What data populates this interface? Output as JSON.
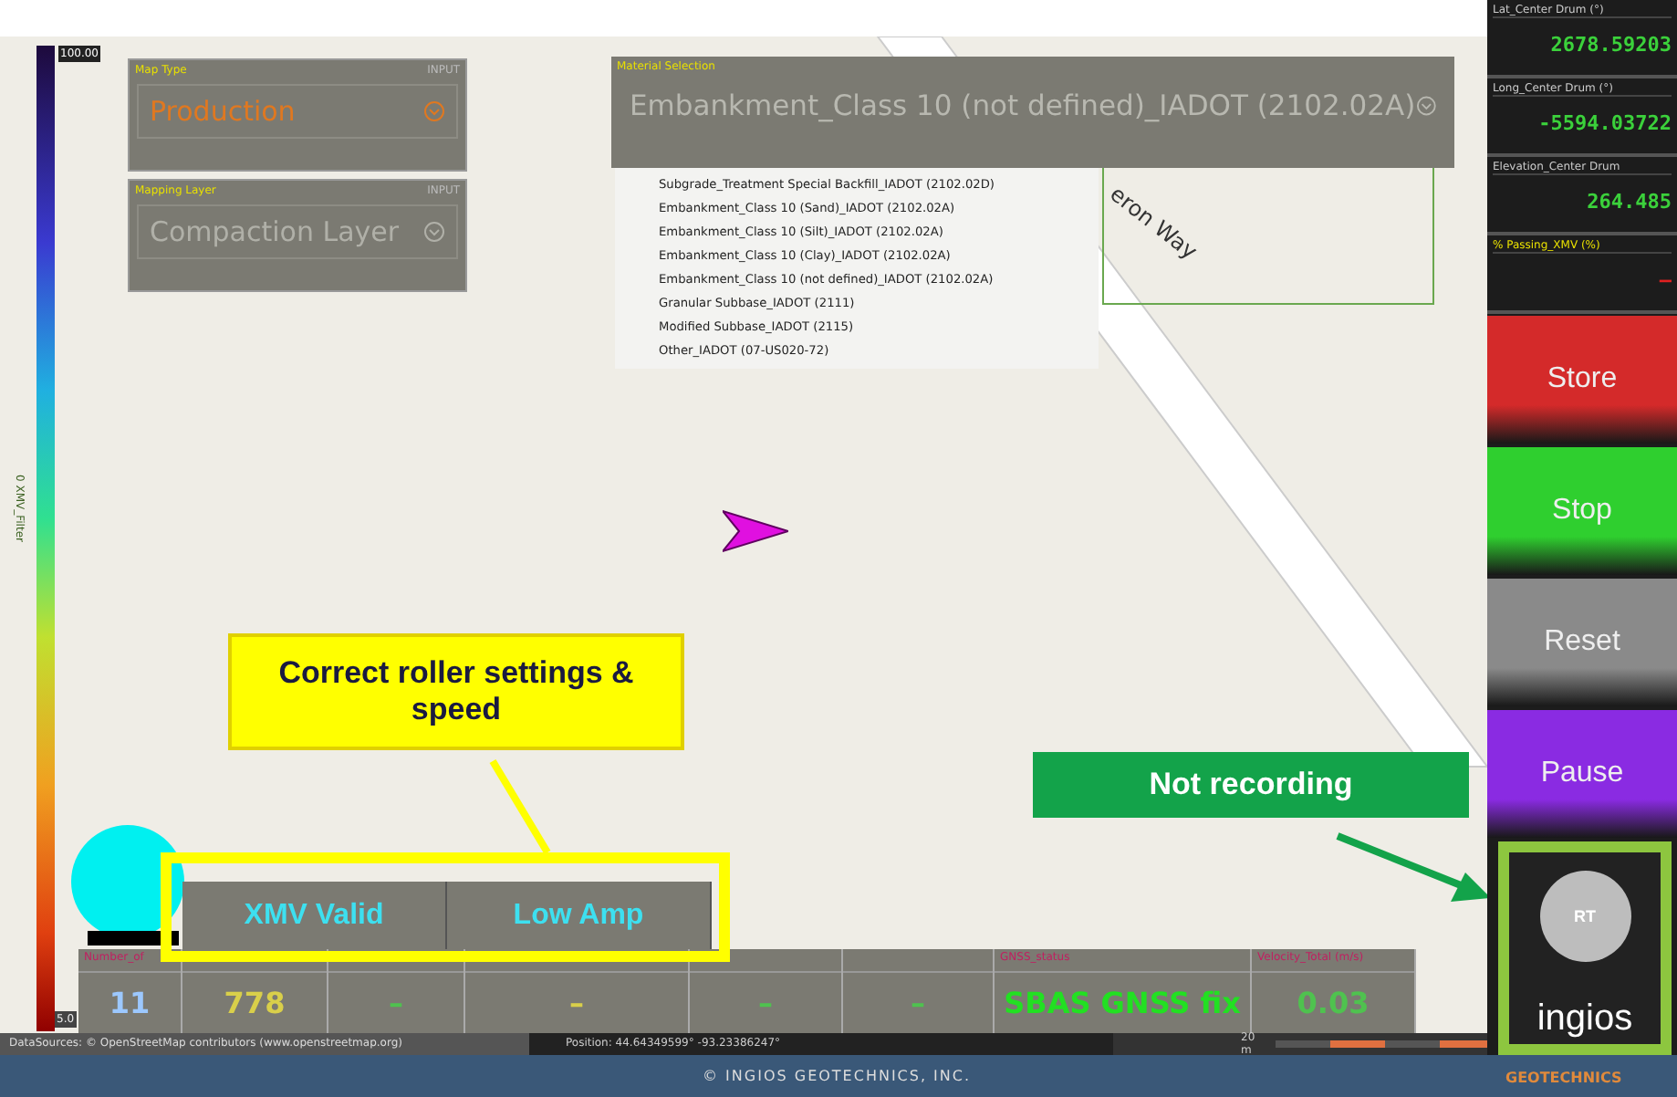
{
  "legend": {
    "max": "100.00",
    "min": "5.0",
    "label": "0 XMV_Filter"
  },
  "map_type": {
    "title": "Map Type",
    "tag": "INPUT",
    "value": "Production"
  },
  "mapping_layer": {
    "title": "Mapping Layer",
    "tag": "INPUT",
    "value": "Compaction Layer"
  },
  "material_selection": {
    "title": "Material Selection",
    "value": "Embankment_Class 10 (not defined)_IADOT (2102.02A)",
    "options": [
      {
        "label": "Subgrade_Treatment Special Backfill_IADOT (2102.02D)"
      },
      {
        "label": "Embankment_Class 10 (Sand)_IADOT (2102.02A)"
      },
      {
        "label": "Embankment_Class 10 (Silt)_IADOT (2102.02A)"
      },
      {
        "label": "Embankment_Class 10 (Clay)_IADOT (2102.02A)"
      },
      {
        "label": "Embankment_Class 10 (not defined)_IADOT (2102.02A)"
      },
      {
        "label": "Granular Subbase_IADOT (2111)"
      },
      {
        "label": "Modified Subbase_IADOT (2115)"
      },
      {
        "label": "Other_IADOT (07-US020-72)"
      }
    ]
  },
  "street_label": "eron Way",
  "callouts": [
    {
      "text": "Correct roller settings & speed",
      "kind": "yellow"
    },
    {
      "text": "Not recording",
      "kind": "green"
    }
  ],
  "status_flags": [
    "XMV Valid",
    "Low Amp"
  ],
  "tiles": [
    {
      "label": "Number_of",
      "value": "11",
      "color": "#9cc8ff"
    },
    {
      "value": "778",
      "color": "#d9cf4a"
    },
    {
      "value": "–",
      "color": "#4fc24f"
    },
    {
      "value": "–",
      "color": "#d9cf4a"
    },
    {
      "value": "–",
      "color": "#4fc24f"
    },
    {
      "value": "–",
      "color": "#4fc24f"
    },
    {
      "label": "GNSS_status",
      "value": "SBAS GNSS fix",
      "color": "#22e022"
    },
    {
      "label": "Velocity_Total (m/s)",
      "value": "0.03",
      "color": "#4fc24f"
    }
  ],
  "status_bar": {
    "sources": "DataSources: © OpenStreetMap contributors (www.openstreetmap.org)",
    "position": "Position: 44.64349599° -93.23386247°",
    "scale": "20 m"
  },
  "readouts": [
    {
      "label": "Lat_Center Drum (°)",
      "value": "2678.59203",
      "color": "#3bd13b"
    },
    {
      "label": "Long_Center Drum (°)",
      "value": "-5594.03722",
      "color": "#3bd13b"
    },
    {
      "label": "Elevation_Center Drum",
      "value": "264.485",
      "color": "#3bd13b"
    },
    {
      "label": "% Passing_XMV (%)",
      "value": "—",
      "color": "#e02020"
    }
  ],
  "buttons": [
    {
      "label": "Store",
      "color": "#d42a2a"
    },
    {
      "label": "Stop",
      "color": "#2fcf2f"
    },
    {
      "label": "Reset",
      "color": "#8a8a8a"
    },
    {
      "label": "Pause",
      "color": "#8a2be2"
    }
  ],
  "record_button": "RT",
  "logo": {
    "name": "ingios",
    "sub": "GEOTECHNICS"
  },
  "footer": "© INGIOS GEOTECHNICS, INC."
}
